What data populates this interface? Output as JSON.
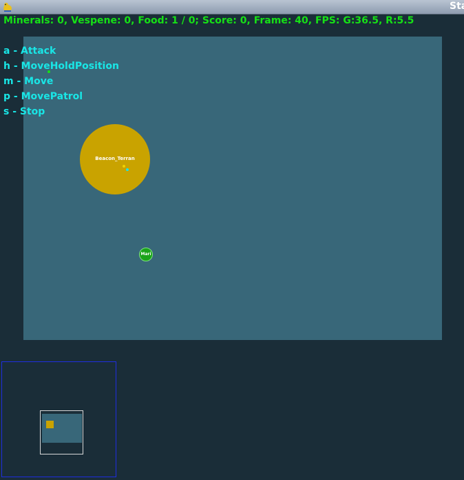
{
  "window": {
    "title": "Sta"
  },
  "status": {
    "text": "Minerals: 0, Vespene: 0, Food: 1 / 0; Score: 0, Frame: 40, FPS: G:36.5, R:5.5"
  },
  "hotkeys": [
    {
      "text": "a - Attack"
    },
    {
      "text": "h - MoveHoldPosition"
    },
    {
      "text": "m - Move"
    },
    {
      "text": "p - MovePatrol"
    },
    {
      "text": "s - Stop"
    }
  ],
  "units": {
    "beacon": {
      "label": "Beacon_Terran"
    },
    "marine": {
      "label": "Mari"
    }
  },
  "colors": {
    "status_text": "#16e016",
    "hotkey_text": "#19e6e6",
    "map_background": "#386779",
    "window_background": "#1a2d38",
    "beacon": "#c9a300",
    "marine": "#1aa31a",
    "minimap_border": "#1f2ee0"
  },
  "icons": {
    "app": "pygame-snake-icon"
  }
}
